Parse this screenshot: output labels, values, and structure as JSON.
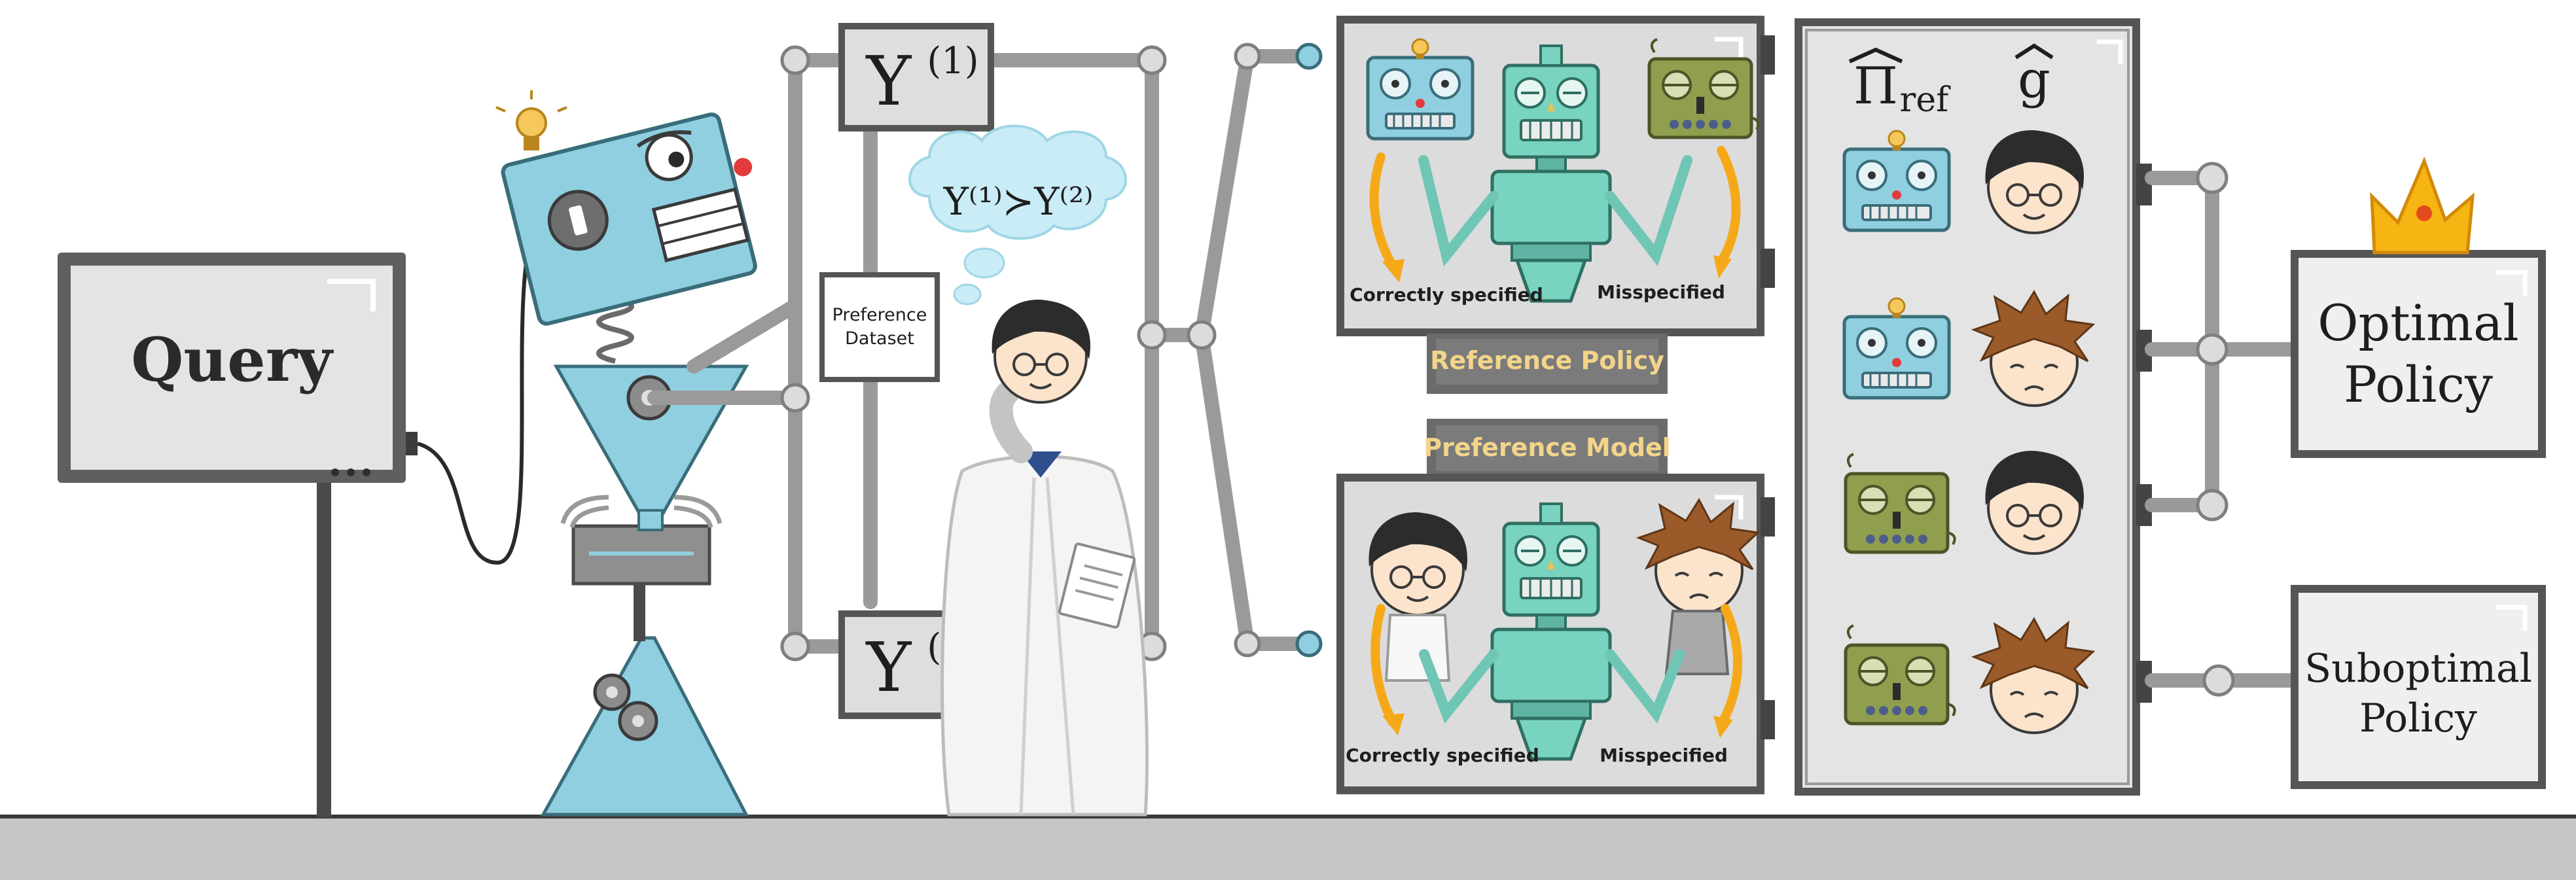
{
  "query_box": {
    "label": "Query"
  },
  "responses": {
    "y1_base": "Y",
    "y1_sup": "(1)",
    "y2_base": "Y",
    "y2_sup": "(2)"
  },
  "thought_bubble": {
    "text": "Y⁽¹⁾≻Y⁽²⁾"
  },
  "dataset_box": {
    "line1": "Preference",
    "line2": "Dataset"
  },
  "reference_panel": {
    "left_caption": "Correctly specified",
    "right_caption": "Misspecified",
    "tag": "Reference Policy"
  },
  "preference_panel": {
    "tag": "Preference Model",
    "left_caption": "Correctly specified",
    "right_caption": "Misspecified"
  },
  "combination_panel": {
    "header_pi_base": "Π",
    "header_pi_sub": "ref",
    "header_g": "g"
  },
  "outcomes": {
    "optimal_line1": "Optimal",
    "optimal_line2": "Policy",
    "suboptimal_line1": "Suboptimal",
    "suboptimal_line2": "Policy"
  },
  "colors": {
    "robot_blue": "#8fcfe0",
    "robot_teal": "#78d3bf",
    "robot_olive": "#8f9f4e",
    "arrow_orange": "#f6a918",
    "tag_text": "#f2d58a",
    "tag_bg": "#6b6b6b",
    "crown": "#f7b514"
  }
}
